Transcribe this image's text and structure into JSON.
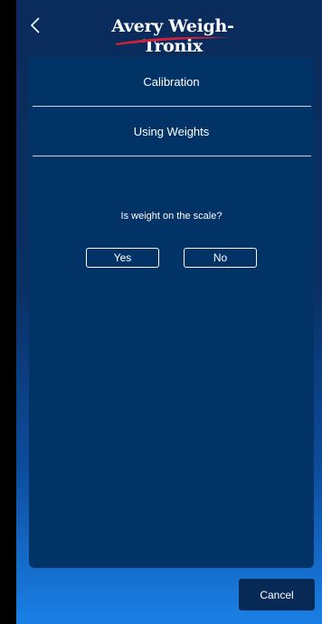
{
  "header": {
    "logo_text": "Avery Weigh-Tronix",
    "back_icon": "chevron-left-icon"
  },
  "panel": {
    "title": "Calibration",
    "subtitle": "Using Weights",
    "question": "Is weight on the scale?",
    "yes_label": "Yes",
    "no_label": "No"
  },
  "footer": {
    "cancel_label": "Cancel"
  },
  "colors": {
    "panel": "#023366",
    "cancel": "#062a55",
    "logo_swoosh": "#d0203a",
    "text": "#ffffff"
  }
}
